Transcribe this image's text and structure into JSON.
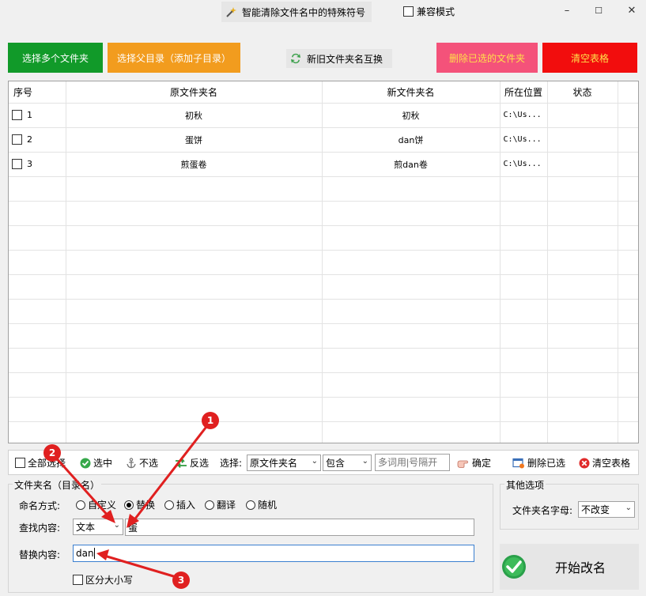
{
  "window": {
    "title": "智能清除文件名中的特殊符号",
    "compat_mode_label": "兼容模式",
    "minimize": "–",
    "maximize": "☐",
    "close": "✕"
  },
  "top_buttons": {
    "select_multiple": "选择多个文件夹",
    "select_parent": "选择父目录（添加子目录）",
    "swap_names": "新旧文件夹名互换",
    "delete_selected": "删除已选的文件夹",
    "clear_table": "清空表格"
  },
  "colors": {
    "select_multiple": "#119a29",
    "select_parent": "#f29c1e",
    "delete_selected": "#f4527a",
    "clear_table": "#f20d0d",
    "annotation": "#e02020"
  },
  "table": {
    "headers": [
      "序号",
      "原文件夹名",
      "新文件夹名",
      "所在位置",
      "状态"
    ],
    "rows": [
      {
        "index": "1",
        "original": "初秋",
        "new": "初秋",
        "location": "C:\\Us...",
        "status": ""
      },
      {
        "index": "2",
        "original": "蛋饼",
        "new": "dan饼",
        "location": "C:\\Us...",
        "status": ""
      },
      {
        "index": "3",
        "original": "煎蛋卷",
        "new": "煎dan卷",
        "location": "C:\\Us...",
        "status": ""
      }
    ]
  },
  "toolbar": {
    "select_all": "全部选择",
    "check": "选中",
    "uncheck": "不选",
    "invert": "反选",
    "select_label": "选择:",
    "column_value": "原文件夹名",
    "match_value": "包含",
    "keywords_placeholder": "多词用|号隔开",
    "confirm": "确定",
    "delete_selected": "删除已选",
    "clear_table": "清空表格"
  },
  "rename": {
    "group_title": "文件夹名（目录名）",
    "mode_label": "命名方式:",
    "modes": [
      "自定义",
      "替换",
      "插入",
      "翻译",
      "随机"
    ],
    "selected_mode": "替换",
    "find_label": "查找内容:",
    "find_type": "文本",
    "find_value": "蛋",
    "replace_label": "替换内容:",
    "replace_value": "dan",
    "case_sensitive": "区分大小写"
  },
  "other": {
    "group_title": "其他选项",
    "letter_case_label": "文件夹名字母:",
    "letter_case_value": "不改变"
  },
  "start_button": "开始改名",
  "annotations": [
    "1",
    "2",
    "3"
  ]
}
